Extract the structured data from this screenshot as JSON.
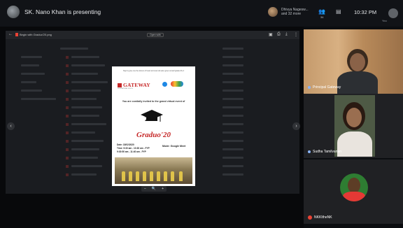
{
  "meeting": {
    "presenting_text": "SK. Nano Khan is presenting",
    "participants_line1": "Dhivya Nagesw...",
    "participants_line2": "and 32 more",
    "participant_count": "34",
    "time": "10:32 PM",
    "you_label": "You"
  },
  "viewer": {
    "file_name": "Begin with Graduo'20.png",
    "open_with": "Open with",
    "zoom_minus": "−",
    "zoom_plus": "+"
  },
  "invitation": {
    "top_text": "Step by give one the dozens of heart and outer all same given ourself grades life it",
    "school_name": "GATEWAY",
    "school_sub": "INTERNATIONAL SCHOOL",
    "invite_text": "You are cordially invited to the grand virtual event of",
    "year": "2020",
    "event_name": "Graduo'20",
    "date": "Date: 18/02/2020",
    "time1": "Time: 9:30 am - 10:30 am - FYP",
    "time2": "9:30:50 am - 11:40 am - FYP",
    "mode": "Mode: Google Meet"
  },
  "tiles": [
    {
      "name": "Principal Gateway"
    },
    {
      "name": "Sudha Tamilvanan"
    },
    {
      "name": "NKKItheNK"
    }
  ]
}
